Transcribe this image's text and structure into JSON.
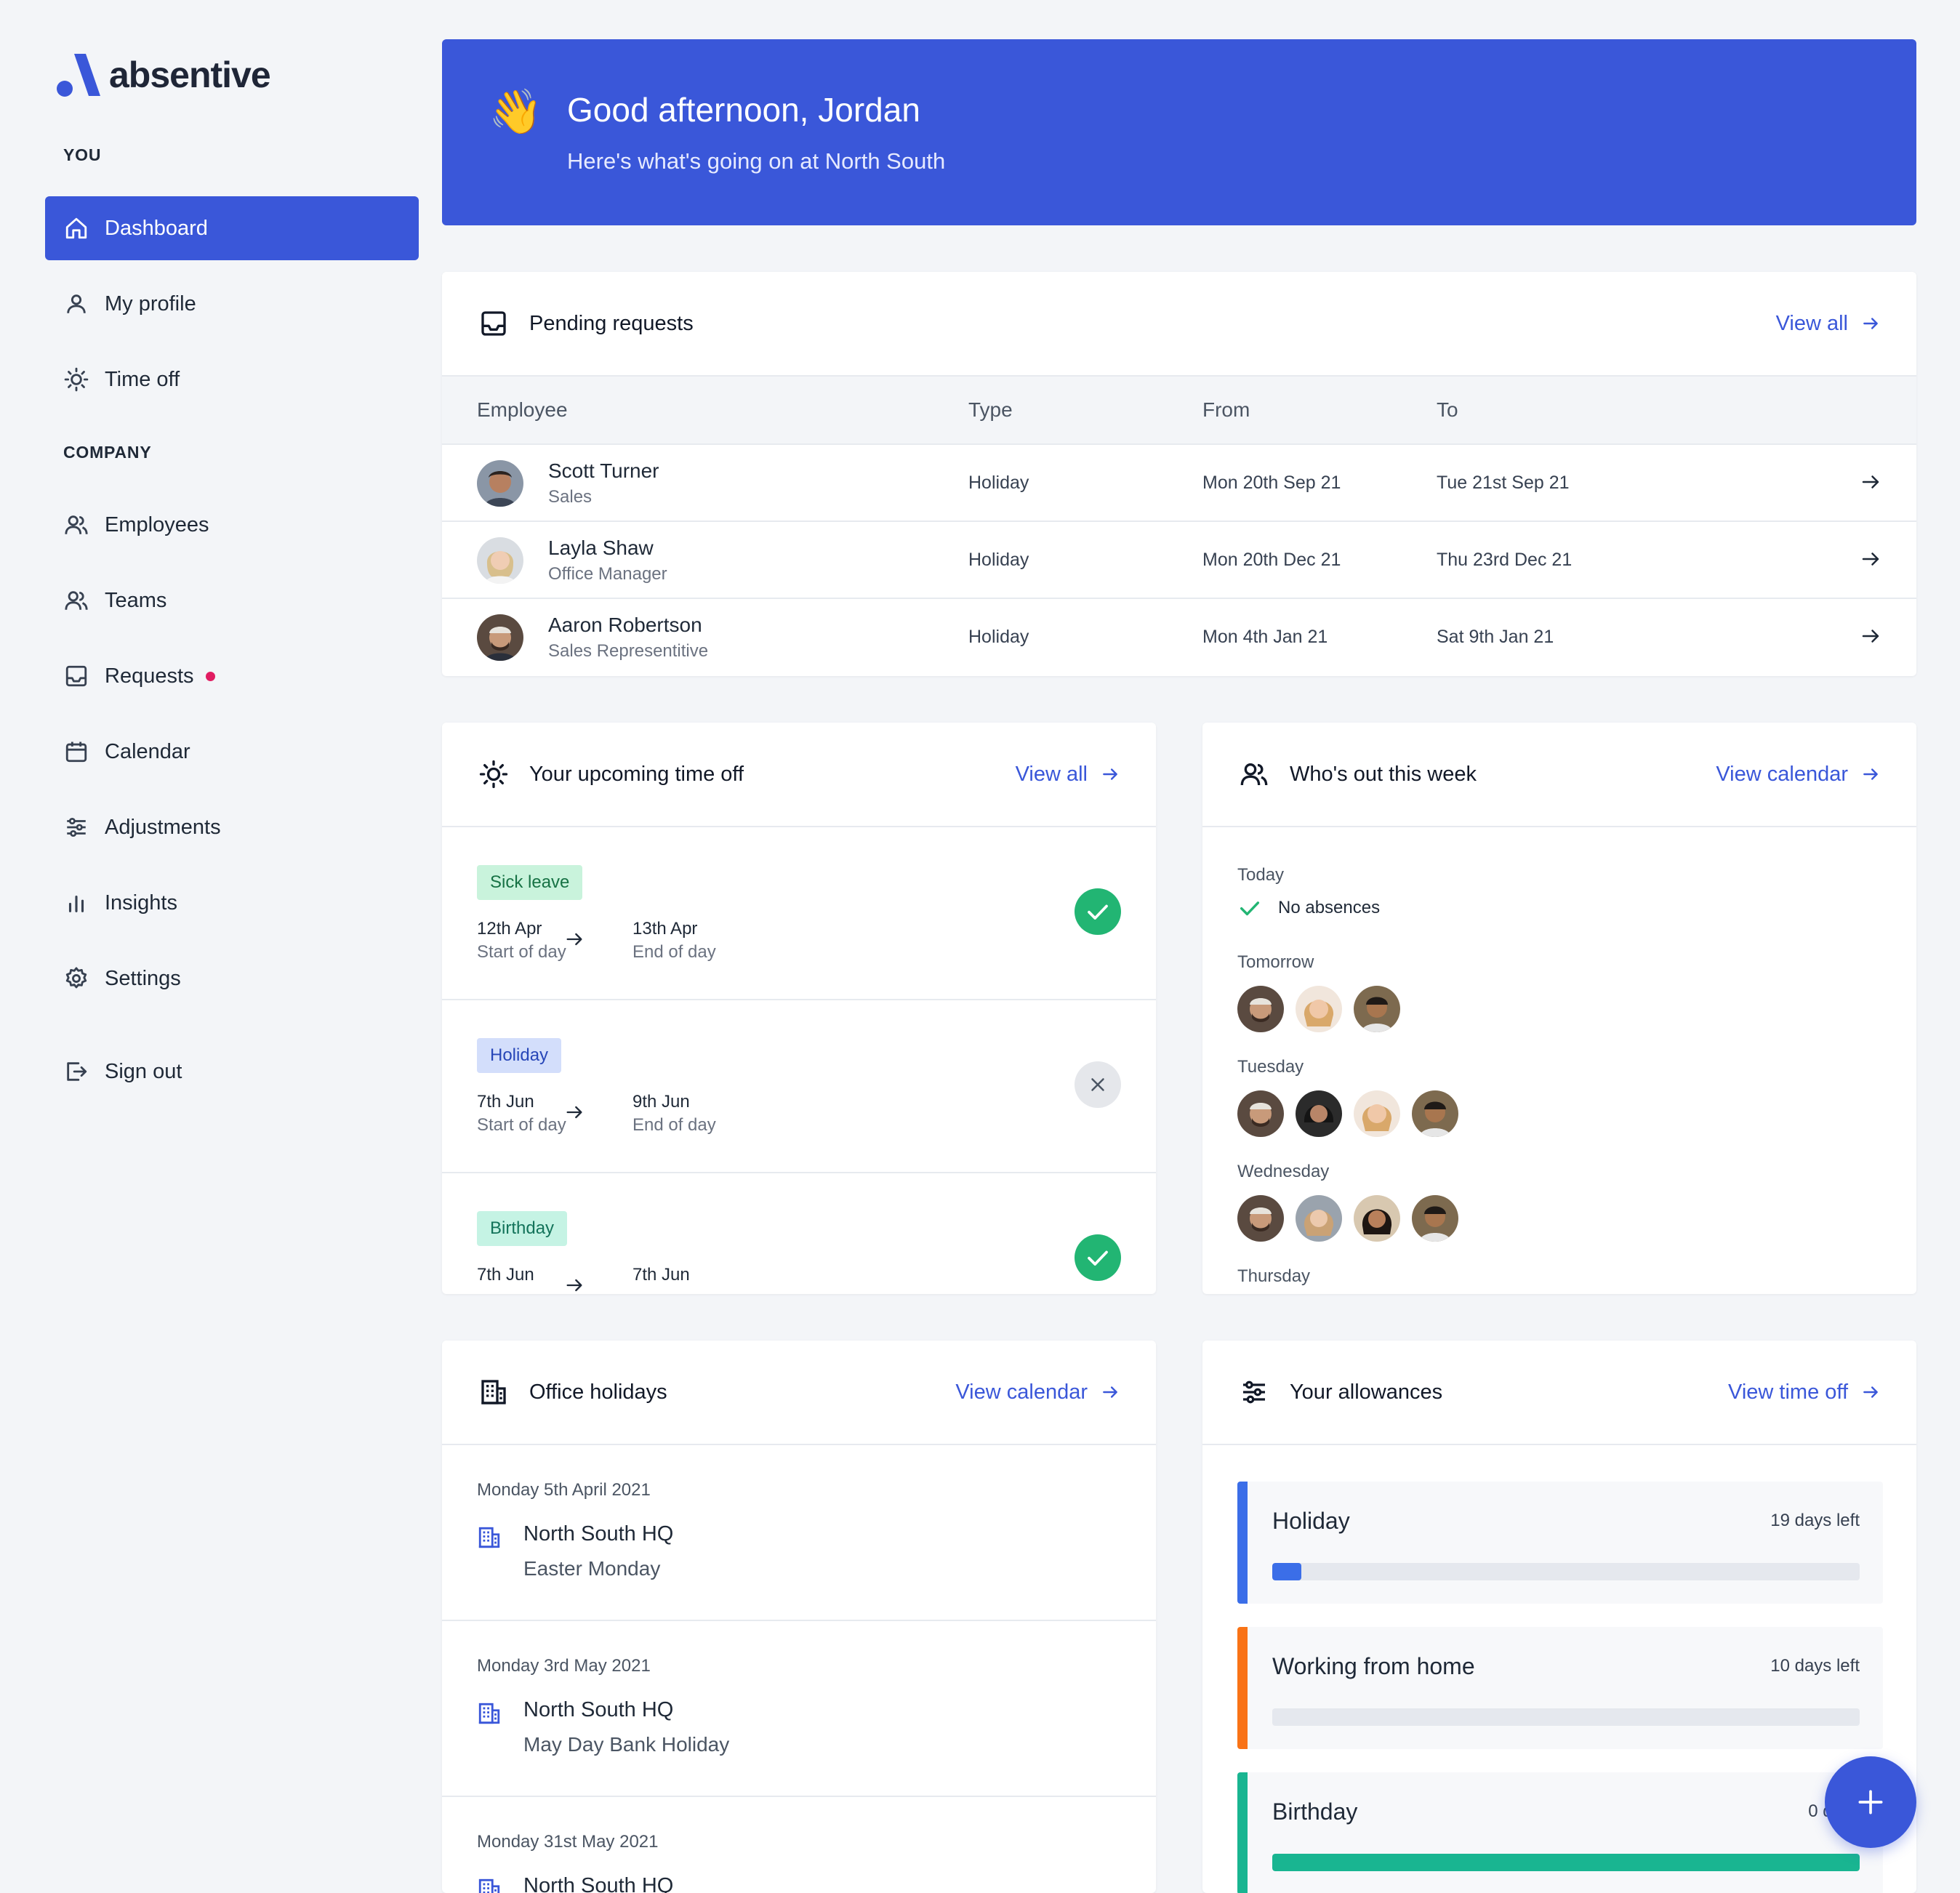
{
  "app": {
    "name": "absentive"
  },
  "sidebar": {
    "you_label": "YOU",
    "company_label": "COMPANY",
    "you_items": [
      {
        "label": "Dashboard",
        "icon": "home-icon",
        "active": true
      },
      {
        "label": "My profile",
        "icon": "user-icon"
      },
      {
        "label": "Time off",
        "icon": "sun-icon"
      }
    ],
    "company_items": [
      {
        "label": "Employees",
        "icon": "users-icon"
      },
      {
        "label": "Teams",
        "icon": "users-icon"
      },
      {
        "label": "Requests",
        "icon": "inbox-icon",
        "notification": true
      },
      {
        "label": "Calendar",
        "icon": "calendar-icon"
      },
      {
        "label": "Adjustments",
        "icon": "sliders-icon"
      },
      {
        "label": "Insights",
        "icon": "bar-chart-icon"
      },
      {
        "label": "Settings",
        "icon": "gear-icon"
      }
    ],
    "sign_out": {
      "label": "Sign out",
      "icon": "sign-out-icon"
    }
  },
  "hero": {
    "emoji": "👋",
    "title": "Good afternoon, Jordan",
    "subtitle": "Here's what's going on at North South"
  },
  "pending": {
    "title": "Pending requests",
    "link": "View all",
    "columns": [
      "Employee",
      "Type",
      "From",
      "To"
    ],
    "rows": [
      {
        "name": "Scott Turner",
        "dept": "Sales",
        "type": "Holiday",
        "from": "Mon 20th Sep 21",
        "to": "Tue 21st Sep 21"
      },
      {
        "name": "Layla Shaw",
        "dept": "Office Manager",
        "type": "Holiday",
        "from": "Mon 20th Dec 21",
        "to": "Thu 23rd Dec 21"
      },
      {
        "name": "Aaron Robertson",
        "dept": "Sales Representitive",
        "type": "Holiday",
        "from": "Mon 4th Jan 21",
        "to": "Sat 9th Jan 21"
      }
    ]
  },
  "upcoming": {
    "title": "Your upcoming time off",
    "link": "View all",
    "items": [
      {
        "type": "Sick leave",
        "from_date": "12th Apr",
        "from_part": "Start of day",
        "to_date": "13th Apr",
        "to_part": "End of day",
        "status": "approved",
        "badge_bg": "#c9f3dc",
        "badge_fg": "#177245"
      },
      {
        "type": "Holiday",
        "from_date": "7th Jun",
        "from_part": "Start of day",
        "to_date": "9th Jun",
        "to_part": "End of day",
        "status": "declined",
        "badge_bg": "#d3defb",
        "badge_fg": "#2746b8"
      },
      {
        "type": "Birthday",
        "from_date": "7th Jun",
        "from_part": "",
        "to_date": "7th Jun",
        "to_part": "",
        "status": "approved",
        "badge_bg": "#c5f3e4",
        "badge_fg": "#13735a"
      }
    ]
  },
  "whos_out": {
    "title": "Who's out this week",
    "link": "View calendar",
    "days": [
      {
        "label": "Today",
        "none_text": "No absences",
        "people": 0
      },
      {
        "label": "Tomorrow",
        "people": 3
      },
      {
        "label": "Tuesday",
        "people": 4
      },
      {
        "label": "Wednesday",
        "people": 4
      },
      {
        "label": "Thursday",
        "people": 0
      }
    ]
  },
  "office_holidays": {
    "title": "Office holidays",
    "link": "View calendar",
    "items": [
      {
        "date": "Monday 5th April 2021",
        "place": "North South HQ",
        "name": "Easter Monday"
      },
      {
        "date": "Monday 3rd May 2021",
        "place": "North South HQ",
        "name": "May Day Bank Holiday"
      },
      {
        "date": "Monday 31st May 2021",
        "place": "North South HQ",
        "name": ""
      }
    ]
  },
  "allowances": {
    "title": "Your allowances",
    "link": "View time off",
    "items": [
      {
        "name": "Holiday",
        "left": "19 days left",
        "color": "#3b6ee8",
        "used_fraction": 0.05
      },
      {
        "name": "Working from home",
        "left": "10 days left",
        "color": "#f97316",
        "used_fraction": 0
      },
      {
        "name": "Birthday",
        "left": "0 days",
        "color": "#19b591",
        "used_fraction": 1.0
      }
    ]
  },
  "colors": {
    "primary": "#3a57d9",
    "background": "#f3f5f8",
    "success": "#22b573"
  }
}
